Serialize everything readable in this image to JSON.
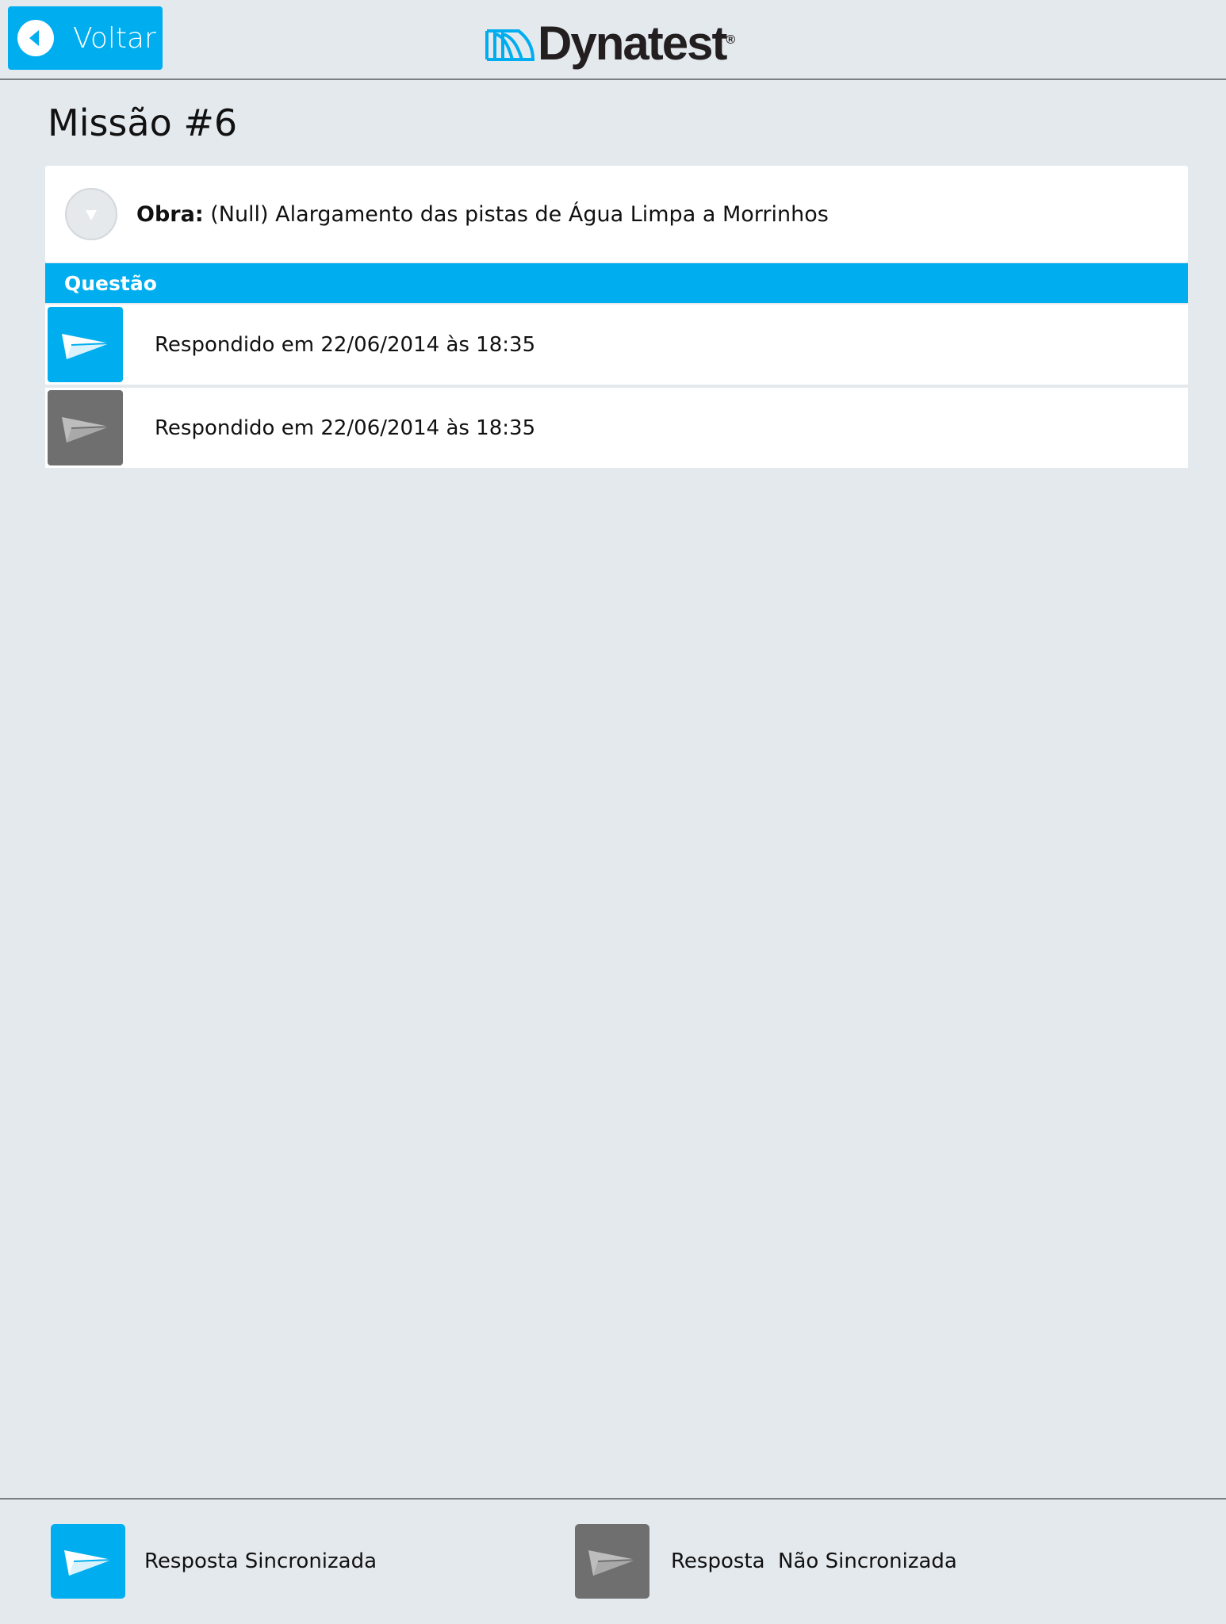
{
  "header": {
    "back_label": "Voltar",
    "logo_text": "Dynatest",
    "logo_reg": "®"
  },
  "page": {
    "title": "Missão #6"
  },
  "obra": {
    "label": "Obra:",
    "value": " (Null) Alargamento das pistas de Água Limpa a Morrinhos"
  },
  "questions": {
    "header": "Questão",
    "rows": [
      {
        "text": "Respondido em 22/06/2014 às 18:35",
        "status": "synced"
      },
      {
        "text": "Respondido em 22/06/2014 às 18:35",
        "status": "not-synced"
      }
    ]
  },
  "legend": {
    "synced_label": "Resposta Sincronizada",
    "not_synced_label": "Resposta  Não Sincronizada"
  },
  "colors": {
    "accent": "#00aeef",
    "gray_icon": "#6f6f6f",
    "background": "#e4e9ee"
  }
}
